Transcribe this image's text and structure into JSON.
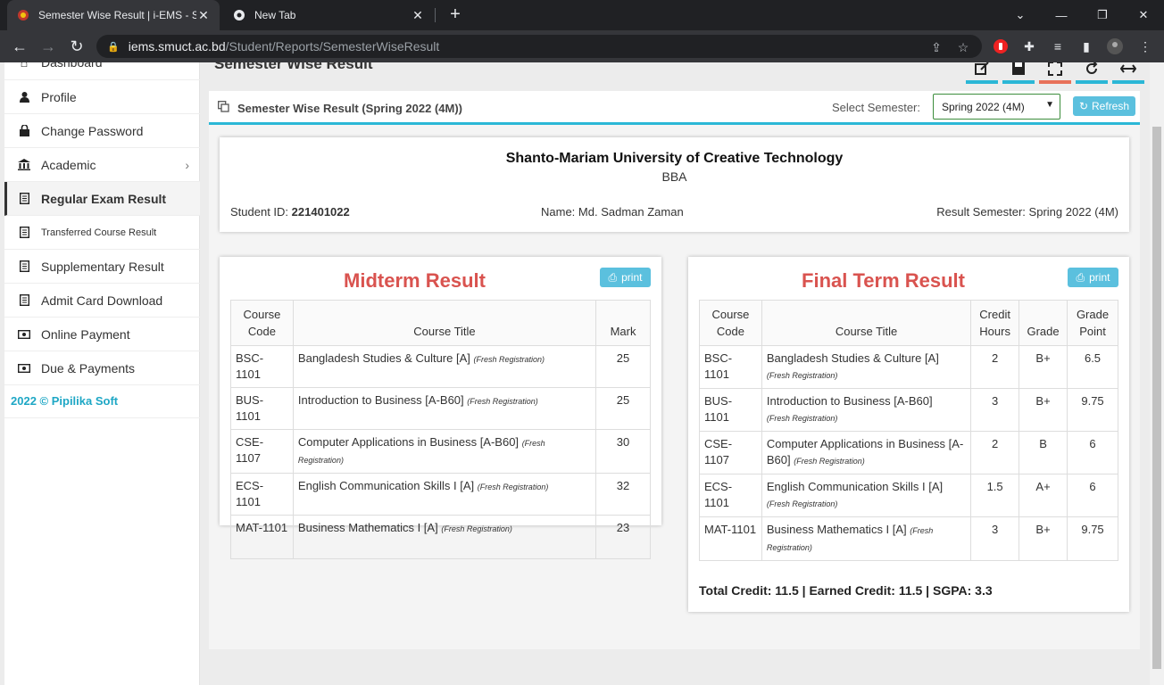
{
  "browser": {
    "active_tab_title": "Semester Wise Result | i-EMS - SI",
    "inactive_tab_title": "New Tab",
    "url_host": "iems.smuct.ac.bd",
    "url_path": "/Student/Reports/SemesterWiseResult"
  },
  "sidebar": {
    "partial_item": "Dashboard",
    "items": [
      {
        "label": "Profile",
        "icon": "user-icon"
      },
      {
        "label": "Change Password",
        "icon": "lock-icon"
      },
      {
        "label": "Academic",
        "icon": "bank-icon"
      },
      {
        "label": "Regular Exam Result",
        "icon": "document-icon"
      },
      {
        "label": "Transferred Course Result",
        "icon": "document-icon"
      },
      {
        "label": "Supplementary Result",
        "icon": "document-icon"
      },
      {
        "label": "Admit Card Download",
        "icon": "document-icon"
      },
      {
        "label": "Online Payment",
        "icon": "money-icon"
      },
      {
        "label": "Due & Payments",
        "icon": "money-icon"
      }
    ],
    "copyright": "2022 © Pipilika Soft"
  },
  "page": {
    "title": "Semester Wise Result",
    "box_title": "Semester Wise Result (Spring 2022 (4M))",
    "select_label": "Select Semester:",
    "select_value": "Spring 2022 (4M)",
    "refresh_label": "Refresh"
  },
  "student": {
    "university": "Shanto-Mariam University of Creative Technology",
    "department": "BBA",
    "id_label": "Student ID:",
    "id": "221401022",
    "name_label": "Name:",
    "name": "Md. Sadman Zaman",
    "semester_label": "Result Semester:",
    "semester": "Spring 2022 (4M)"
  },
  "midterm": {
    "title": "Midterm Result",
    "print_label": "print",
    "headers": [
      "Course Code",
      "Course Title",
      "Mark"
    ],
    "rows": [
      {
        "code": "BSC-1101",
        "title": "Bangladesh Studies & Culture [A]",
        "note": "(Fresh Registration)",
        "mark": "25"
      },
      {
        "code": "BUS-1101",
        "title": "Introduction to Business [A-B60]",
        "note": "(Fresh Registration)",
        "mark": "25"
      },
      {
        "code": "CSE-1107",
        "title": "Computer Applications in Business [A-B60]",
        "note": "(Fresh Registration)",
        "mark": "30"
      },
      {
        "code": "ECS-1101",
        "title": "English Communication Skills I [A]",
        "note": "(Fresh Registration)",
        "mark": "32"
      },
      {
        "code": "MAT-1101",
        "title": "Business Mathematics I [A]",
        "note": "(Fresh Registration)",
        "mark": "23"
      }
    ]
  },
  "final": {
    "title": "Final Term Result",
    "print_label": "print",
    "headers": [
      "Course Code",
      "Course Title",
      "Credit Hours",
      "Grade",
      "Grade Point"
    ],
    "rows": [
      {
        "code": "BSC-1101",
        "title": "Bangladesh Studies & Culture [A]",
        "note": "(Fresh Registration)",
        "credit": "2",
        "grade": "B+",
        "point": "6.5"
      },
      {
        "code": "BUS-1101",
        "title": "Introduction to Business [A-B60]",
        "note": "(Fresh Registration)",
        "credit": "3",
        "grade": "B+",
        "point": "9.75"
      },
      {
        "code": "CSE-1107",
        "title": "Computer Applications in Business [A-B60]",
        "note": "(Fresh Registration)",
        "credit": "2",
        "grade": "B",
        "point": "6"
      },
      {
        "code": "ECS-1101",
        "title": "English Communication Skills I [A]",
        "note": "(Fresh Registration)",
        "credit": "1.5",
        "grade": "A+",
        "point": "6"
      },
      {
        "code": "MAT-1101",
        "title": "Business Mathematics I [A]",
        "note": "(Fresh Registration)",
        "credit": "3",
        "grade": "B+",
        "point": "9.75"
      }
    ],
    "summary": "Total Credit: 11.5 | Earned Credit: 11.5 | SGPA: 3.3"
  },
  "colors": {
    "accent": "#2bb7d6",
    "title_red": "#d9534f",
    "info_button": "#5bc0de"
  }
}
